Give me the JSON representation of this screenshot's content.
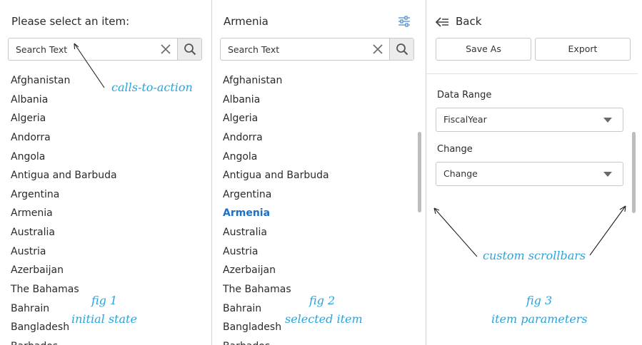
{
  "countries": [
    "Afghanistan",
    "Albania",
    "Algeria",
    "Andorra",
    "Angola",
    "Antigua and Barbuda",
    "Argentina",
    "Armenia",
    "Australia",
    "Austria",
    "Azerbaijan",
    "The Bahamas",
    "Bahrain",
    "Bangladesh",
    "Barbados"
  ],
  "fig1": {
    "title": "Please select an item:",
    "search": {
      "placeholder": "Search Text"
    },
    "caption_line1": "fig 1",
    "caption_line2": "initial state"
  },
  "fig2": {
    "title": "Armenia",
    "selected": "Armenia",
    "search": {
      "placeholder": "Search Text"
    },
    "caption_line1": "fig 2",
    "caption_line2": "selected item"
  },
  "fig3": {
    "back_label": "Back",
    "save_as_label": "Save As",
    "export_label": "Export",
    "data_range_label": "Data Range",
    "data_range_value": "FiscalYear",
    "change_label": "Change",
    "change_value": "Change",
    "caption_line1": "fig 3",
    "caption_line2": "item parameters"
  },
  "annotations": {
    "calls_to_action": "calls-to-action",
    "custom_scrollbars": "custom scrollbars"
  },
  "colors": {
    "accent": "#1f6fc5",
    "annotation": "#2aa4dd",
    "scrollbar": "#bdbdbd"
  }
}
